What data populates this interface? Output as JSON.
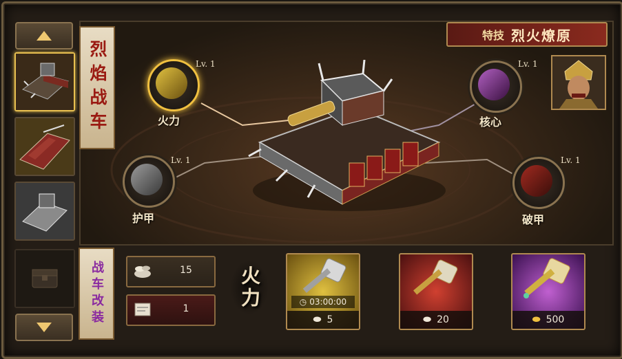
{
  "vehicle_title": "烈焰战车",
  "skill": {
    "key": "特技",
    "value": "烈火燎原"
  },
  "nodes": {
    "firepower": {
      "label": "火力",
      "level": "Lv. 1"
    },
    "core": {
      "label": "核心",
      "level": "Lv. 1"
    },
    "armor": {
      "label": "护甲",
      "level": "Lv. 1"
    },
    "armor_break": {
      "label": "破甲",
      "level": "Lv. 1"
    }
  },
  "modify_title": "战车改装",
  "resources": [
    {
      "value": "15"
    },
    {
      "value": "1"
    }
  ],
  "selected_attribute": "火力",
  "upgrade_options": [
    {
      "timer": "03:00:00",
      "cost": "5",
      "currency": "silver",
      "color": "#c8a020"
    },
    {
      "cost": "20",
      "currency": "silver",
      "color": "#b03020"
    },
    {
      "cost": "500",
      "currency": "gold",
      "color": "#8a30a0"
    }
  ],
  "colors": {
    "accent": "#f0c040",
    "frame": "#6b5a3e"
  }
}
